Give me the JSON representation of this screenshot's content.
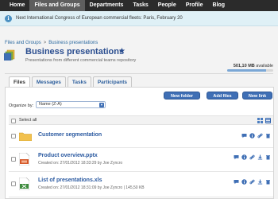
{
  "nav": {
    "items": [
      {
        "label": "Home",
        "active": false
      },
      {
        "label": "Files and Groups",
        "active": true
      },
      {
        "label": "Departments",
        "active": false
      },
      {
        "label": "Tasks",
        "active": false
      },
      {
        "label": "People",
        "active": false
      },
      {
        "label": "Profile",
        "active": false
      },
      {
        "label": "Blog",
        "active": false
      }
    ]
  },
  "notice": {
    "icon": "info-icon",
    "icon_glyph": "i",
    "text": "Next International Congress of European commercial fleets: Paris, February 20"
  },
  "breadcrumb": {
    "items": [
      "Files and Groups",
      "Business presentations"
    ],
    "separator": ">"
  },
  "header": {
    "title": "Business presentations",
    "star_glyph": "★",
    "subtitle": "Presentations from different commercial teams repository",
    "storage_used": "501,10 MB",
    "storage_suffix": "available",
    "storage_fraction": 0.85
  },
  "tabs": [
    {
      "label": "Files",
      "active": true
    },
    {
      "label": "Messages",
      "active": false
    },
    {
      "label": "Tasks",
      "active": false
    },
    {
      "label": "Participants",
      "active": false
    }
  ],
  "toolbar": {
    "new_folder": "New folder",
    "add_files": "Add files",
    "new_link": "New link"
  },
  "organize": {
    "label": "Organize by:",
    "selected": "Name (Z-A)"
  },
  "list": {
    "select_all": "Select all",
    "rows": [
      {
        "type": "folder",
        "name": "Customer segmentation",
        "meta": ""
      },
      {
        "type": "ppt",
        "name": "Product overview.pptx",
        "meta": "Created on: 27/01/2012 18:33:29 by Joe Zyncro"
      },
      {
        "type": "xls",
        "name": "List of presentations.xls",
        "meta": "Created on: 27/01/2012 18:31:09 by Joe Zyncro | 145,50 KB"
      }
    ]
  },
  "colors": {
    "accent": "#3f6fb5",
    "link": "#2a59a0",
    "nav_bg": "#2b2b2b",
    "nav_active": "#5e5e5e"
  }
}
